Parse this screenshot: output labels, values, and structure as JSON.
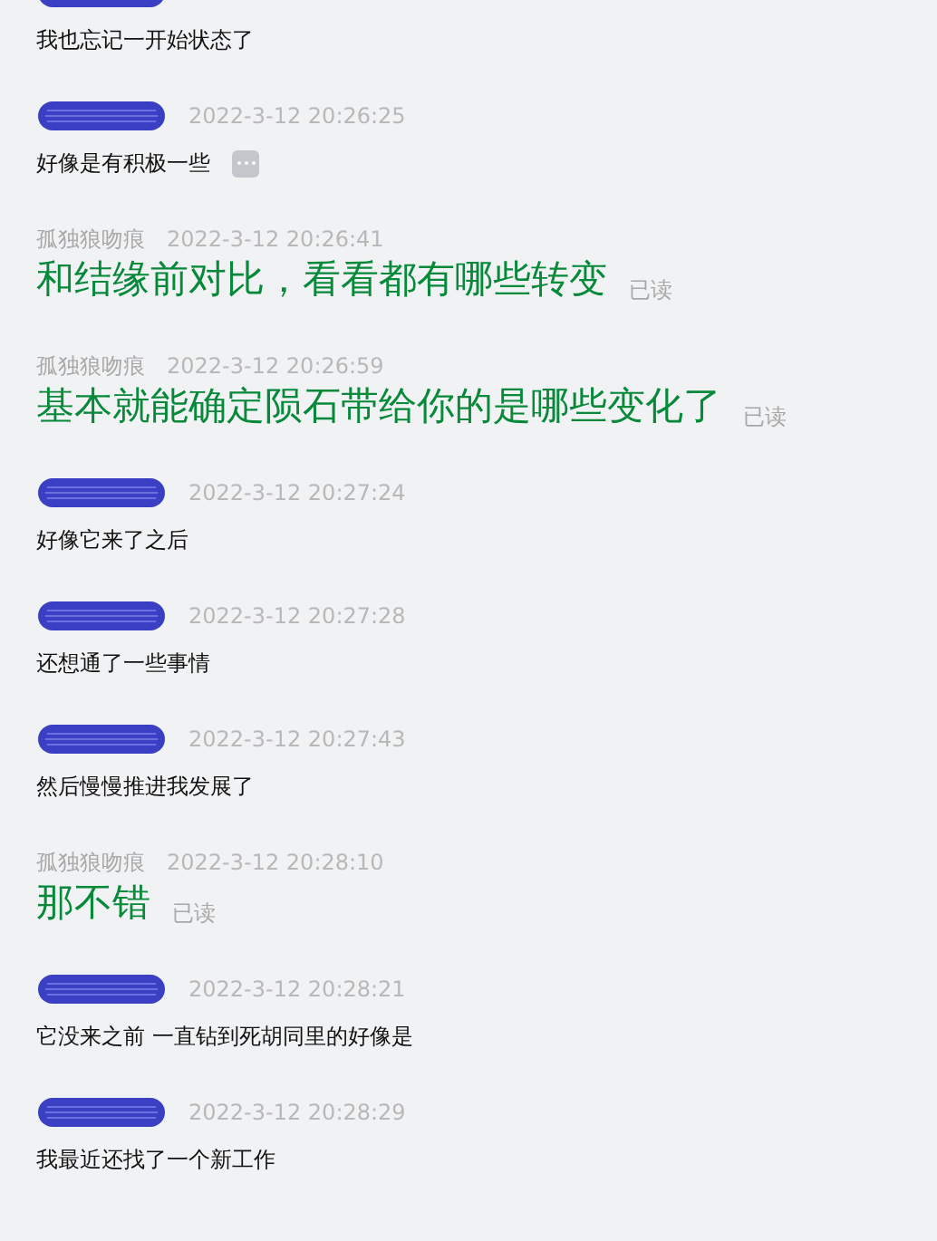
{
  "messages": [
    {
      "kind": "other",
      "text": "我也忘记一开始状态了",
      "more": false
    },
    {
      "kind": "other",
      "time": "2022-3-12 20:26:25",
      "text": "好像是有积极一些",
      "more": true
    },
    {
      "kind": "self",
      "sender": "孤独狼吻痕",
      "time": "2022-3-12 20:26:41",
      "text": "和结缘前对比，看看都有哪些转变",
      "receipt": "已读"
    },
    {
      "kind": "self",
      "sender": "孤独狼吻痕",
      "time": "2022-3-12 20:26:59",
      "text": "基本就能确定陨石带给你的是哪些变化了",
      "receipt": "已读"
    },
    {
      "kind": "other",
      "time": "2022-3-12 20:27:24",
      "text": "好像它来了之后",
      "more": false
    },
    {
      "kind": "other",
      "time": "2022-3-12 20:27:28",
      "text": "还想通了一些事情",
      "more": false
    },
    {
      "kind": "other",
      "time": "2022-3-12 20:27:43",
      "text": "然后慢慢推进我发展了",
      "more": false
    },
    {
      "kind": "self",
      "sender": "孤独狼吻痕",
      "time": "2022-3-12 20:28:10",
      "text": "那不错",
      "receipt": "已读"
    },
    {
      "kind": "other",
      "time": "2022-3-12 20:28:21",
      "text": "它没来之前 一直钻到死胡同里的好像是",
      "more": false
    },
    {
      "kind": "other",
      "time": "2022-3-12 20:28:29",
      "text": "我最近还找了一个新工作",
      "more": false
    }
  ]
}
